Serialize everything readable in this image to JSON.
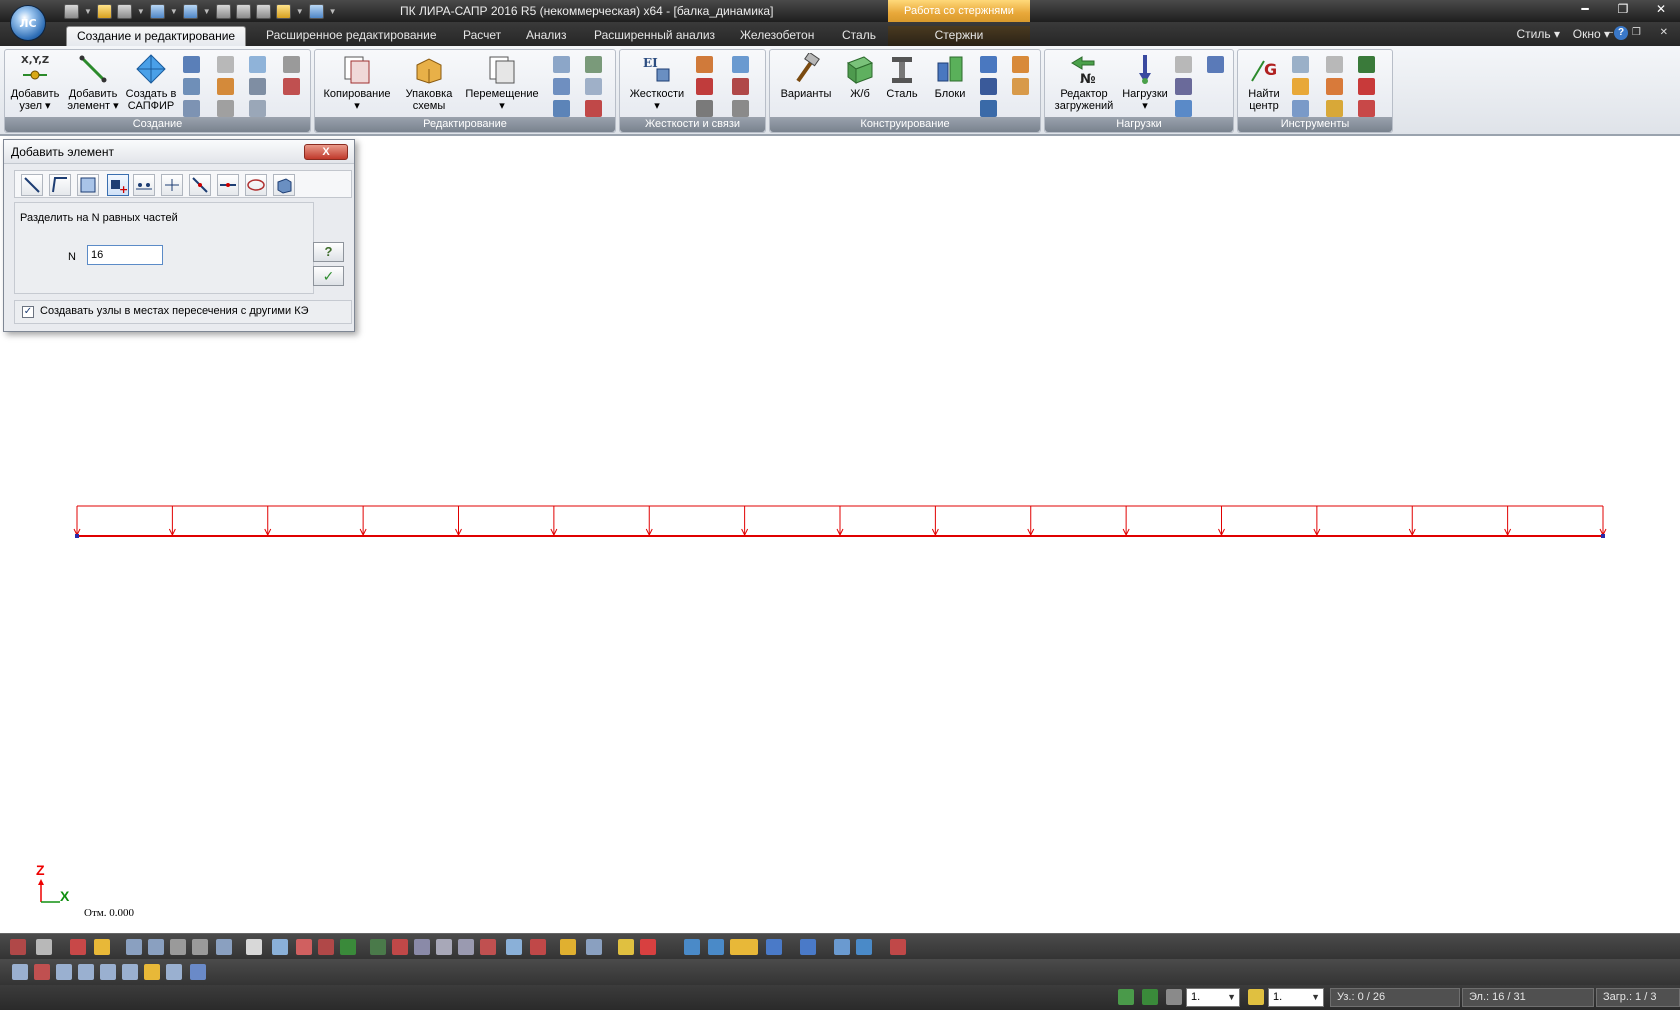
{
  "window": {
    "title": "ПК ЛИРА-САПР  2016 R5 (некоммерческая) x64 - [балка_динамика]",
    "context_tab_header": "Работа со стержнями",
    "logo_text": "ЛС"
  },
  "ribbon_tabs": {
    "create_edit": "Создание и редактирование",
    "advanced_edit": "Расширенное редактирование",
    "calculation": "Расчет",
    "analysis": "Анализ",
    "advanced_analysis": "Расширенный анализ",
    "reinforced_concrete": "Железобетон",
    "steel": "Сталь",
    "rods": "Стержни"
  },
  "menu_right": {
    "style": "Стиль",
    "window": "Окно",
    "help": "?"
  },
  "ribbon": {
    "creation": {
      "label": "Создание",
      "xyz_label": "X,Y,Z",
      "add_node": "Добавить узел",
      "add_element": "Добавить элемент",
      "create_sapfir": "Создать в САПФИР"
    },
    "editing": {
      "label": "Редактирование",
      "copy": "Копирование",
      "pack": "Упаковка схемы",
      "move": "Перемещение"
    },
    "stiffness": {
      "label": "Жесткости и связи",
      "stiffness": "Жесткости",
      "ei_label": "EI"
    },
    "design": {
      "label": "Конструирование",
      "variants": "Варианты",
      "rc": "Ж/б",
      "steel": "Сталь",
      "blocks": "Блоки"
    },
    "loads": {
      "label": "Нагрузки",
      "load_editor": "Редактор загружений",
      "loads": "Нагрузки",
      "no_label": "№"
    },
    "tools": {
      "label": "Инструменты",
      "find_center": "Найти центр",
      "g_label": "G"
    }
  },
  "dialog": {
    "title": "Добавить элемент",
    "close": "X",
    "section": "Разделить на N равных частей",
    "n_label": "N",
    "n_value": "16",
    "help": "?",
    "ok": "✓",
    "create_nodes_label": "Создавать узлы в местах пересечения с другими КЭ",
    "create_nodes_checked": "✓"
  },
  "canvas": {
    "axis_z": "Z",
    "axis_x": "X",
    "elevation": "Отм. 0.000",
    "segments": 16
  },
  "statusbar": {
    "load_combo": "1.",
    "case_combo": "1.",
    "nodes": "Уз.: 0 / 26",
    "elements": "Эл.: 16 / 31",
    "loads": "Загр.: 1 / 3"
  },
  "colors": {
    "beam": "#e00000",
    "node": "#2a2aa8"
  }
}
